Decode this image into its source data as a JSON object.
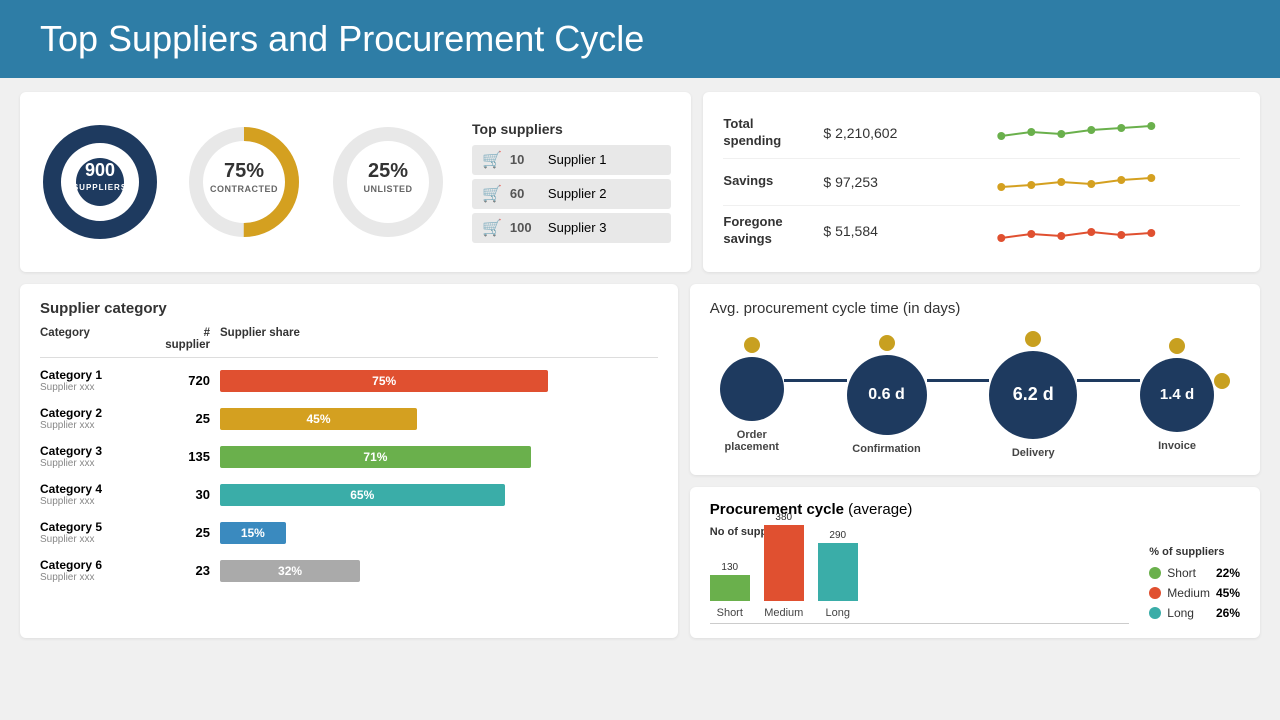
{
  "header": {
    "title": "Top Suppliers and Procurement Cycle"
  },
  "kpi": {
    "suppliers": {
      "value": "900",
      "label": "SUPPLIERS",
      "color": "#1e3a5f",
      "bg": "#1e3a5f"
    },
    "contracted": {
      "value": "75%",
      "label": "CONTRACTED",
      "color": "#d4a020",
      "percentage": 75
    },
    "unlisted": {
      "value": "25%",
      "label": "UNLISTED",
      "color": "#6ab04c",
      "percentage": 25
    }
  },
  "top_suppliers": {
    "title": "Top suppliers",
    "items": [
      {
        "num": 10,
        "name": "Supplier 1"
      },
      {
        "num": 60,
        "name": "Supplier 2"
      },
      {
        "num": 100,
        "name": "Supplier 3"
      }
    ]
  },
  "spending": {
    "rows": [
      {
        "label": "Total spending",
        "value": "$ 2,210,602",
        "color": "#6ab04c"
      },
      {
        "label": "Savings",
        "value": "$ 97,253",
        "color": "#d4a020"
      },
      {
        "label": "Foregone savings",
        "value": "$ 51,584",
        "color": "#e05030"
      }
    ]
  },
  "category": {
    "title": "Supplier category",
    "col_category": "Category",
    "col_num": "# supplier",
    "col_share": "Supplier share",
    "rows": [
      {
        "name": "Category 1",
        "sub": "Supplier xxx",
        "num": 720,
        "pct": 75,
        "color": "#e05030"
      },
      {
        "name": "Category 2",
        "sub": "Supplier xxx",
        "num": 25,
        "pct": 45,
        "color": "#d4a020"
      },
      {
        "name": "Category 3",
        "sub": "Supplier xxx",
        "num": 135,
        "pct": 71,
        "color": "#6ab04c"
      },
      {
        "name": "Category 4",
        "sub": "Supplier xxx",
        "num": 30,
        "pct": 65,
        "color": "#3aada8"
      },
      {
        "name": "Category 5",
        "sub": "Supplier xxx",
        "num": 25,
        "pct": 15,
        "color": "#3a8abf"
      },
      {
        "name": "Category 6",
        "sub": "Supplier xxx",
        "num": 23,
        "pct": 32,
        "color": "#aaaaaa"
      }
    ]
  },
  "cycle": {
    "title": "Avg. procurement cycle time",
    "subtitle": "(in days)",
    "nodes": [
      {
        "label": "Order\nplacement",
        "value": null
      },
      {
        "label": "Confirmation",
        "value": "0.6 d"
      },
      {
        "label": "Delivery",
        "value": "6.2 d"
      },
      {
        "label": "Invoice",
        "value": "1.4 d"
      }
    ]
  },
  "procurement_avg": {
    "title": "Procurement cycle",
    "subtitle": "(average)",
    "bar_label": "No of suppliers",
    "bars": [
      {
        "name": "Short",
        "value": 130,
        "color": "#6ab04c"
      },
      {
        "name": "Medium",
        "value": 380,
        "color": "#e05030"
      },
      {
        "name": "Long",
        "value": 290,
        "color": "#3aada8"
      }
    ],
    "legend_title": "% of suppliers",
    "legend": [
      {
        "name": "Short",
        "pct": "22%",
        "color": "#6ab04c"
      },
      {
        "name": "Medium",
        "pct": "45%",
        "color": "#e05030"
      },
      {
        "name": "Long",
        "pct": "26%",
        "color": "#3aada8"
      }
    ]
  }
}
